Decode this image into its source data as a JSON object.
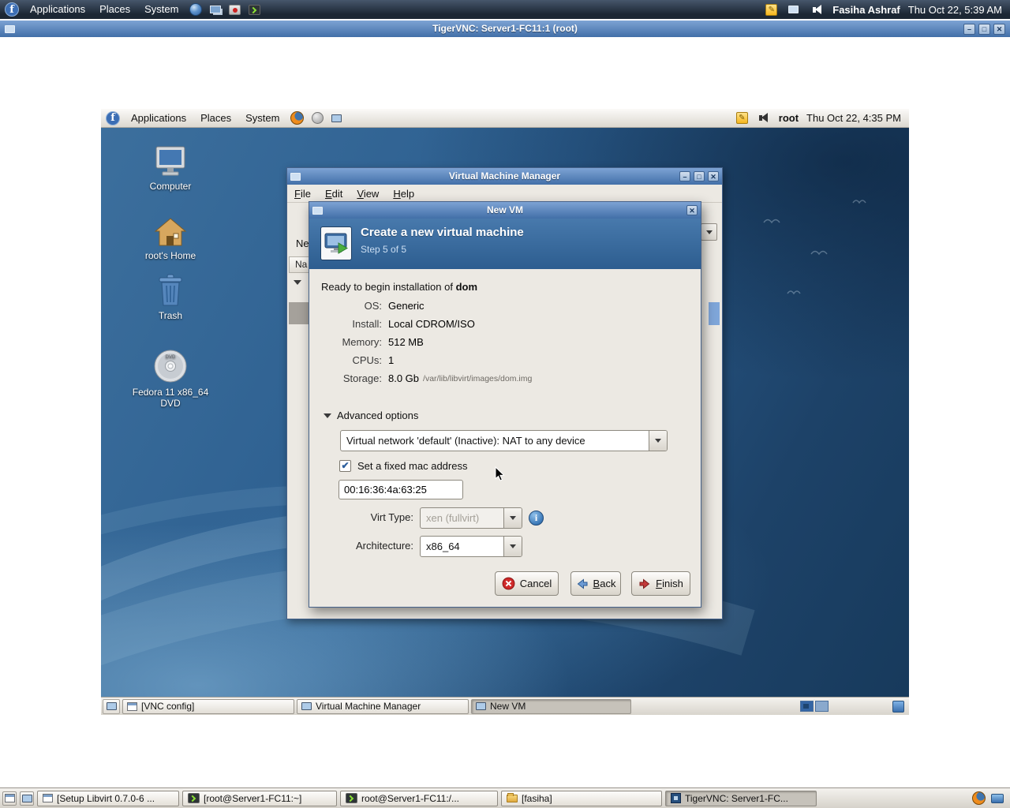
{
  "colors": {
    "titlebar-top": "#7da3d4",
    "titlebar-bottom": "#426fa8",
    "wizard-header": "#336aa3",
    "panel-dark": "#1c2734",
    "selection-blue": "#3465a4",
    "desktop-blue": "#2b5d8e"
  },
  "icons": {
    "logo": "f",
    "minimize": "–",
    "maximize": "□",
    "close": "✕",
    "check": "✔",
    "info": "i",
    "pencil": "✎",
    "dvd_text": "DVD"
  },
  "host": {
    "panel": {
      "menus": [
        "Applications",
        "Places",
        "System"
      ],
      "user": "Fasiha Ashraf",
      "clock": "Thu Oct 22, 5:39 AM"
    },
    "taskbar": {
      "items": [
        {
          "label": "[Setup Libvirt 0.7.0-6 ..."
        },
        {
          "label": "[root@Server1-FC11:~]"
        },
        {
          "label": "root@Server1-FC11:/..."
        },
        {
          "label": "[fasiha]"
        },
        {
          "label": "TigerVNC: Server1-FC..."
        }
      ]
    }
  },
  "vnc": {
    "title": "TigerVNC: Server1-FC11:1 (root)"
  },
  "guest": {
    "panel": {
      "menus": [
        "Applications",
        "Places",
        "System"
      ],
      "user": "root",
      "clock": "Thu Oct 22, 4:35 PM"
    },
    "desktop_icons": [
      {
        "label": "Computer"
      },
      {
        "label": "root's Home"
      },
      {
        "label": "Trash"
      },
      {
        "label": "Fedora 11 x86_64 DVD"
      }
    ],
    "taskbar": {
      "items": [
        {
          "label": "[VNC config]"
        },
        {
          "label": "Virtual Machine Manager"
        },
        {
          "label": "New VM"
        }
      ]
    }
  },
  "vmm": {
    "title": "Virtual Machine Manager",
    "menus": [
      "File",
      "Edit",
      "View",
      "Help"
    ],
    "fragments": {
      "toolbar": "Ne",
      "column_header": "Na"
    }
  },
  "wizard": {
    "title": "New VM",
    "header": {
      "title": "Create a new virtual machine",
      "step": "Step 5 of 5"
    },
    "ready_prefix": "Ready to begin installation of ",
    "vm_name": "dom",
    "summary": [
      {
        "label": "OS:",
        "value": "Generic"
      },
      {
        "label": "Install:",
        "value": "Local CDROM/ISO"
      },
      {
        "label": "Memory:",
        "value": "512 MB"
      },
      {
        "label": "CPUs:",
        "value": "1"
      },
      {
        "label": "Storage:",
        "value": "8.0 Gb",
        "detail": "/var/lib/libvirt/images/dom.img"
      }
    ],
    "advanced_label": "Advanced options",
    "network_value": "Virtual network 'default' (Inactive): NAT to any device",
    "mac_checkbox_label": "Set a fixed mac address",
    "mac_value": "00:16:36:4a:63:25",
    "virt_type_label": "Virt Type:",
    "virt_type_value": "xen (fullvirt)",
    "arch_label": "Architecture:",
    "arch_value": "x86_64",
    "buttons": {
      "cancel": "Cancel",
      "back": "Back",
      "finish": "Finish"
    }
  }
}
